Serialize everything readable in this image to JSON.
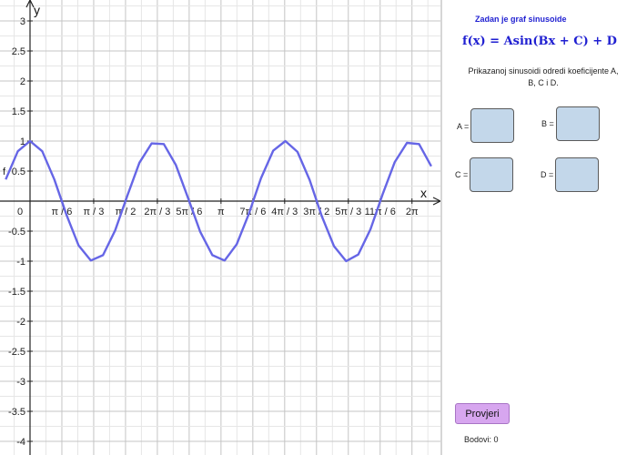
{
  "panel": {
    "title": "Zadan je graf sinusoide",
    "formula": "f(x) = Asin(Bx + C) + D",
    "instruction": "Prikazanoj sinusoidi odredi koeficijente A, B, C i D.",
    "coefficients": [
      {
        "label": "A =",
        "value": ""
      },
      {
        "label": "B =",
        "value": ""
      },
      {
        "label": "C =",
        "value": ""
      },
      {
        "label": "D =",
        "value": ""
      }
    ],
    "check_button": "Provjeri",
    "score": "Bodovi: 0"
  },
  "graph": {
    "function_label": "f",
    "curve_color": "#6666e6"
  },
  "chart_data": {
    "type": "line",
    "xlabel": "x",
    "ylabel": "y",
    "grid": true,
    "x_ticks": [
      "0",
      "π / 6",
      "π / 3",
      "π / 2",
      "2π / 3",
      "5π / 6",
      "π",
      "7π / 6",
      "4π / 3",
      "3π / 2",
      "5π / 3",
      "11π / 6",
      "2π"
    ],
    "x_tick_values": [
      0,
      0.5236,
      1.0472,
      1.5708,
      2.0944,
      2.618,
      3.1416,
      3.6652,
      4.1888,
      4.7124,
      5.236,
      5.7596,
      6.2832
    ],
    "y_ticks": [
      "3",
      "2.5",
      "2",
      "1.5",
      "1",
      "0.5",
      "-0.5",
      "-1",
      "-1.5",
      "-2",
      "-2.5",
      "-3",
      "-3.5",
      "-4"
    ],
    "y_tick_values": [
      3,
      2.5,
      2,
      1.5,
      1,
      0.5,
      -0.5,
      -1,
      -1.5,
      -2,
      -2.5,
      -3,
      -3.5,
      -4
    ],
    "xlim": [
      -0.4,
      6.6
    ],
    "ylim": [
      -4.3,
      3.3
    ],
    "series": [
      {
        "color": "#6666e6",
        "x": [
          -0.4,
          -0.2,
          0,
          0.2,
          0.4,
          0.6,
          0.8,
          1.0,
          1.2,
          1.4,
          1.6,
          1.8,
          2.0,
          2.2,
          2.4,
          2.6,
          2.8,
          3.0,
          3.2,
          3.4,
          3.6,
          3.8,
          4.0,
          4.2,
          4.4,
          4.6,
          4.8,
          5.0,
          5.2,
          5.4,
          5.6,
          5.8,
          6.0,
          6.2,
          6.4,
          6.6
        ],
        "y": [
          0.36,
          0.83,
          1.0,
          0.83,
          0.36,
          -0.23,
          -0.74,
          -0.99,
          -0.9,
          -0.49,
          0.09,
          0.64,
          0.96,
          0.95,
          0.6,
          0.05,
          -0.51,
          -0.9,
          -0.99,
          -0.72,
          -0.21,
          0.38,
          0.84,
          1.0,
          0.82,
          0.35,
          -0.25,
          -0.75,
          -1.0,
          -0.89,
          -0.47,
          0.11,
          0.65,
          0.97,
          0.95,
          0.58
        ]
      }
    ]
  }
}
